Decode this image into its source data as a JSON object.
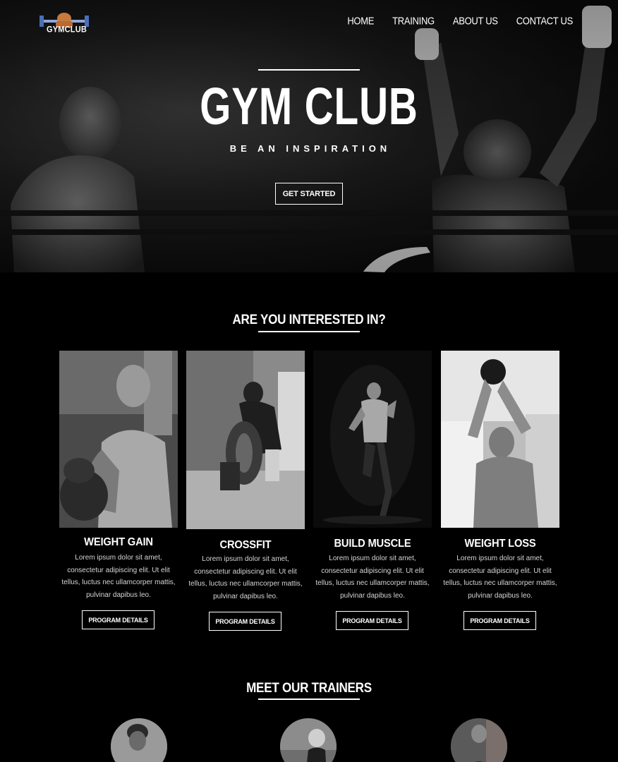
{
  "brand": {
    "logo_text": "GYMCLUB"
  },
  "nav": {
    "items": [
      "HOME",
      "TRAINING",
      "ABOUT US",
      "CONTACT US"
    ]
  },
  "hero": {
    "title": "GYM CLUB",
    "subtitle": "BE AN INSPIRATION",
    "cta_label": "GET STARTED"
  },
  "interests": {
    "heading": "ARE YOU INTERESTED IN?",
    "cards": [
      {
        "title": "WEIGHT GAIN",
        "text": "Lorem ipsum dolor sit amet, consectetur adipiscing elit. Ut elit tellus, luctus nec ullamcorper mattis, pulvinar dapibus leo.",
        "button": "PROGRAM DETAILS"
      },
      {
        "title": "CROSSFIT",
        "text": "Lorem ipsum dolor sit amet, consectetur adipiscing elit. Ut elit tellus, luctus nec ullamcorper mattis, pulvinar dapibus leo.",
        "button": "PROGRAM DETAILS"
      },
      {
        "title": "BUILD MUSCLE",
        "text": "Lorem ipsum dolor sit amet, consectetur adipiscing elit. Ut elit tellus, luctus nec ullamcorper mattis, pulvinar dapibus leo.",
        "button": "PROGRAM DETAILS"
      },
      {
        "title": "WEIGHT LOSS",
        "text": "Lorem ipsum dolor sit amet, consectetur adipiscing elit. Ut elit tellus, luctus nec ullamcorper mattis, pulvinar dapibus leo.",
        "button": "PROGRAM DETAILS"
      }
    ]
  },
  "trainers": {
    "heading": "MEET OUR TRAINERS"
  },
  "colors": {
    "background": "#000000",
    "text": "#ffffff",
    "muted_text": "#d6d6d6",
    "logo_accent": "#4a6fb5"
  }
}
